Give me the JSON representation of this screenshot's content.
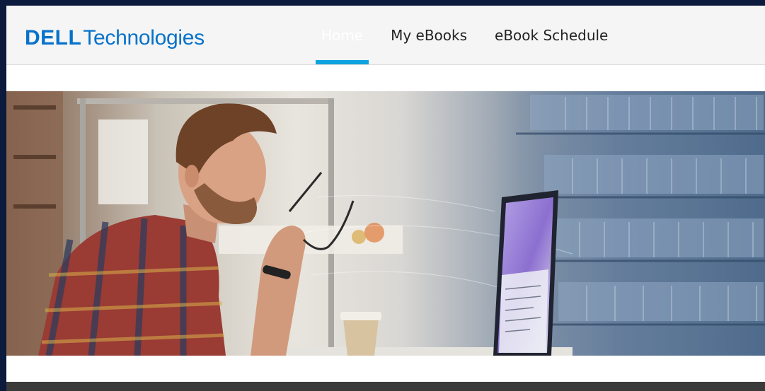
{
  "header": {
    "logo": {
      "brand": "DELL",
      "suffix": "Technologies",
      "color": "#0672cb"
    },
    "nav": [
      {
        "label": "Home",
        "active": true
      },
      {
        "label": "My eBooks",
        "active": false
      },
      {
        "label": "eBook Schedule",
        "active": false
      }
    ],
    "active_indicator_color": "#0ea3e0"
  },
  "hero": {
    "image": "banner-man-with-glasses-at-monitor-bookshelf",
    "elements": [
      "person-icon",
      "glasses-icon",
      "monitor-icon",
      "coffee-cup-icon",
      "bookshelf-background"
    ]
  },
  "colors": {
    "page_background": "#0b1a3d",
    "header_background": "#f5f5f5",
    "footer_strip": "#3a3a3a"
  }
}
